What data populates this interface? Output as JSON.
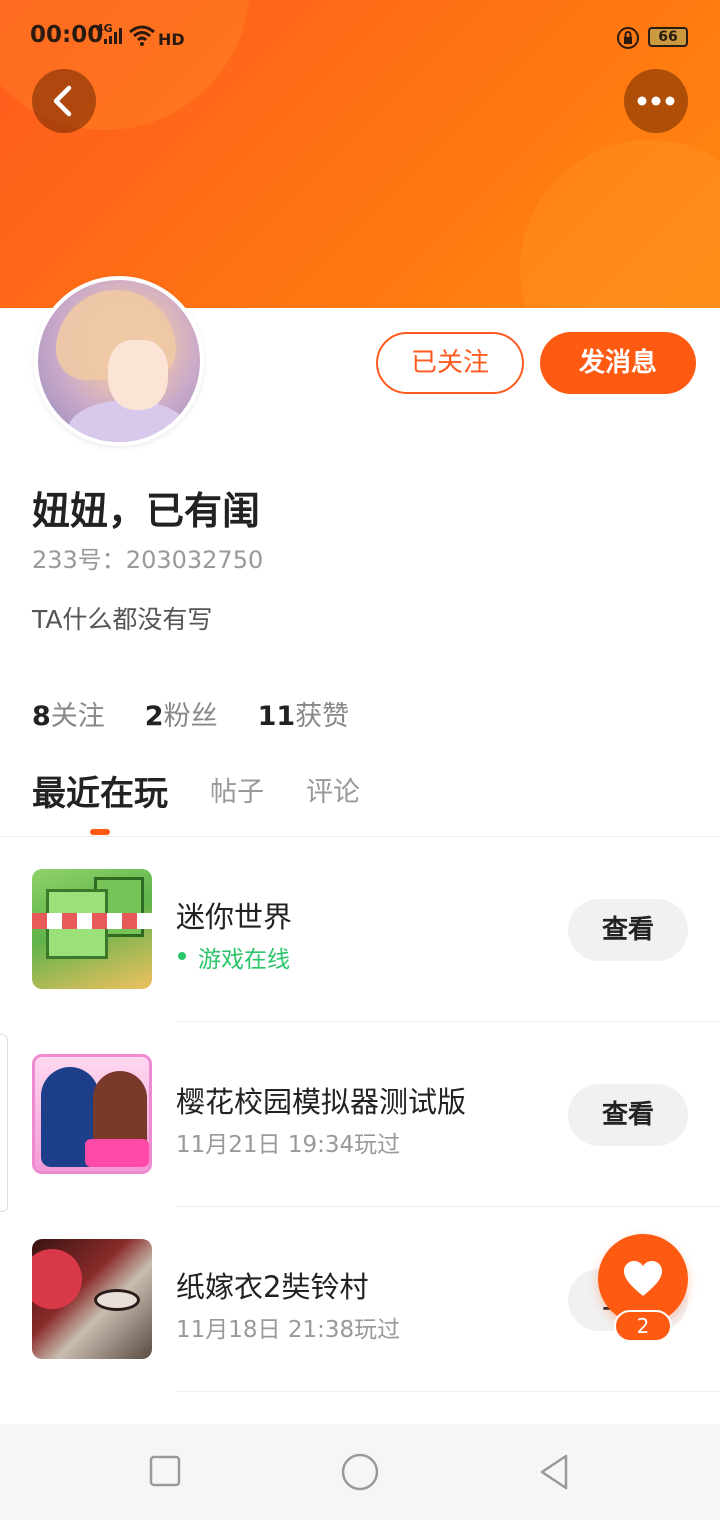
{
  "status_bar": {
    "time": "00:00",
    "network": "4G",
    "hd": "HD",
    "battery": "66"
  },
  "profile": {
    "name": "妞妞，已有闺",
    "uid": "233号：203032750",
    "bio": "TA什么都没有写",
    "follow_button": "已关注",
    "message_button": "发消息",
    "stats": [
      {
        "count": "8",
        "label": "关注"
      },
      {
        "count": "2",
        "label": "粉丝"
      },
      {
        "count": "11",
        "label": "获赞"
      }
    ]
  },
  "tabs": [
    {
      "label": "最近在玩",
      "active": true
    },
    {
      "label": "帖子",
      "active": false
    },
    {
      "label": "评论",
      "active": false
    }
  ],
  "games": [
    {
      "name": "迷你世界",
      "status": "游戏在线",
      "online": true,
      "button": "查看"
    },
    {
      "name": "樱花校园模拟器测试版",
      "status": "11月21日 19:34玩过",
      "online": false,
      "button": "查看"
    },
    {
      "name": "纸嫁衣2奘铃村",
      "status": "11月18日 21:38玩过",
      "online": false,
      "button": "查看"
    }
  ],
  "fab": {
    "count": "2"
  },
  "colors": {
    "accent": "#ff5a12",
    "online": "#2bc56a"
  }
}
